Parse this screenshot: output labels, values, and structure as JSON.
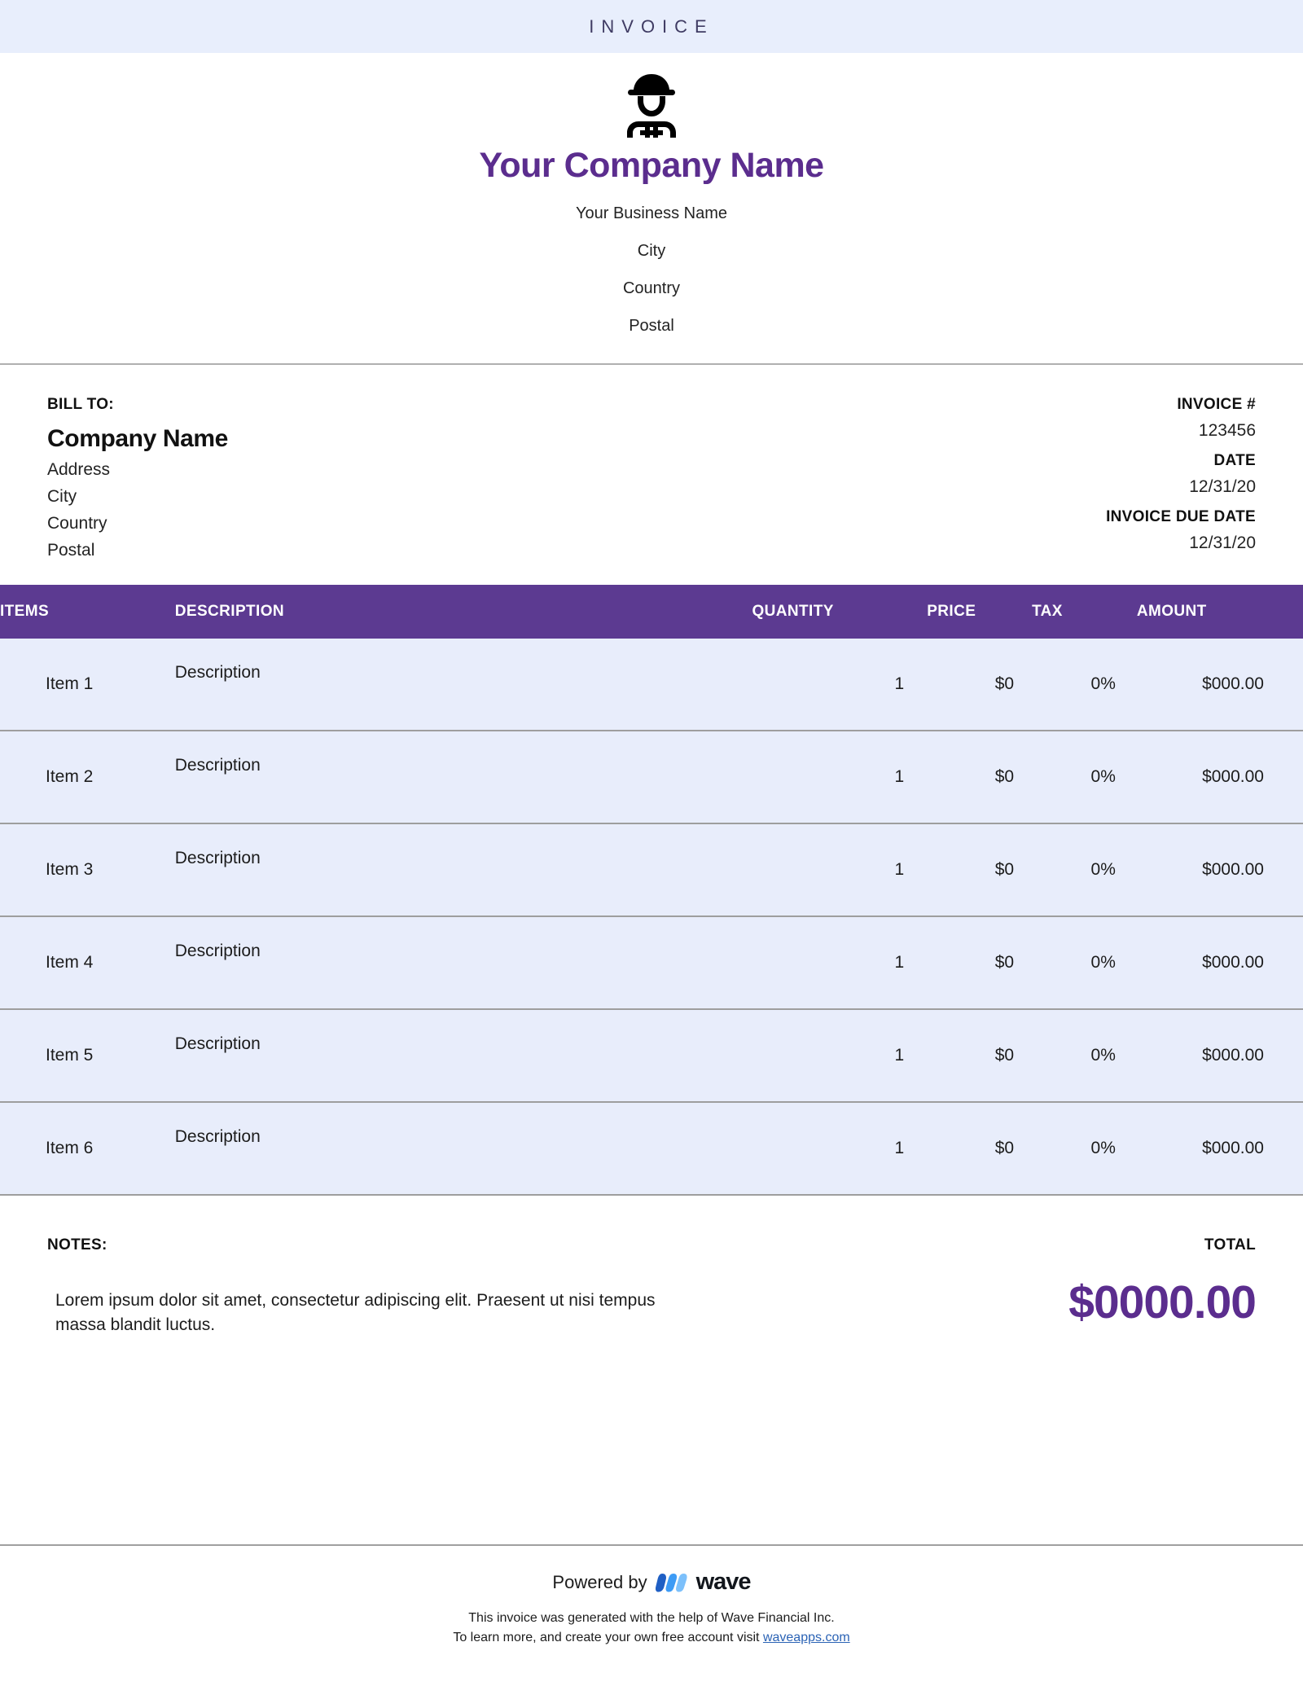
{
  "banner": {
    "title": "INVOICE"
  },
  "brand": {
    "logo_icon": "construction-worker-icon",
    "company_name": "Your Company Name",
    "lines": [
      "Your Business Name",
      "City",
      "Country",
      "Postal"
    ],
    "accent_color": "#5b2d8e",
    "banner_color": "#e8eefc",
    "table_header_color": "#5c3a91",
    "row_color": "#e8edfb"
  },
  "bill_to": {
    "label": "BILL TO:",
    "company": "Company Name",
    "lines": [
      "Address",
      "City",
      "Country",
      "Postal"
    ]
  },
  "invoice_meta": [
    {
      "label": "INVOICE #",
      "value": "123456"
    },
    {
      "label": "DATE",
      "value": "12/31/20"
    },
    {
      "label": "INVOICE DUE DATE",
      "value": "12/31/20"
    }
  ],
  "items_table": {
    "columns": [
      "ITEMS",
      "DESCRIPTION",
      "QUANTITY",
      "PRICE",
      "TAX",
      "AMOUNT"
    ],
    "rows": [
      {
        "item": "Item 1",
        "description": "Description",
        "quantity": "1",
        "price": "$0",
        "tax": "0%",
        "amount": "$000.00"
      },
      {
        "item": "Item 2",
        "description": "Description",
        "quantity": "1",
        "price": "$0",
        "tax": "0%",
        "amount": "$000.00"
      },
      {
        "item": "Item 3",
        "description": "Description",
        "quantity": "1",
        "price": "$0",
        "tax": "0%",
        "amount": "$000.00"
      },
      {
        "item": "Item 4",
        "description": "Description",
        "quantity": "1",
        "price": "$0",
        "tax": "0%",
        "amount": "$000.00"
      },
      {
        "item": "Item 5",
        "description": "Description",
        "quantity": "1",
        "price": "$0",
        "tax": "0%",
        "amount": "$000.00"
      },
      {
        "item": "Item 6",
        "description": "Description",
        "quantity": "1",
        "price": "$0",
        "tax": "0%",
        "amount": "$000.00"
      }
    ]
  },
  "notes": {
    "label": "NOTES:",
    "body": "Lorem ipsum dolor sit amet, consectetur adipiscing elit. Praesent ut nisi tempus massa blandit luctus."
  },
  "total": {
    "label": "TOTAL",
    "amount": "$0000.00"
  },
  "footer": {
    "powered_by": "Powered by",
    "wave_wordmark": "wave",
    "wave_logo_icon": "wave-logo-icon",
    "fineprint_line1": "This invoice was generated with the help of Wave Financial Inc.",
    "fineprint_line2_prefix": "To learn more, and create your own free account visit ",
    "fineprint_link": "waveapps.com"
  }
}
